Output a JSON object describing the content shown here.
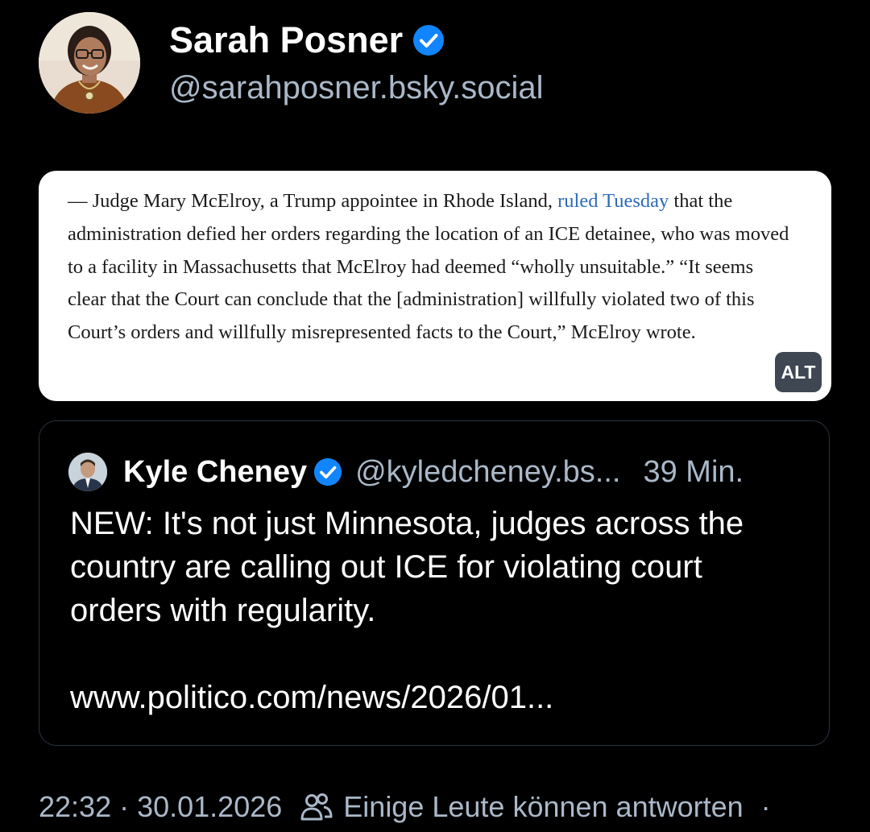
{
  "author": {
    "display_name": "Sarah Posner",
    "handle": "@sarahposner.bsky.social",
    "verified_icon": "verified-checkmark-icon"
  },
  "image_card": {
    "text_before_link": "— Judge Mary McElroy, a Trump appointee in Rhode Island, ",
    "link_text": "ruled Tuesday",
    "text_after_link": " that the administration defied her orders regarding the location of an ICE detainee, who was moved to a facility in Massachusetts that McElroy had deemed “wholly unsuitable.” “It seems clear that the Court can conclude that the [administration] willfully violated two of this Court’s orders and willfully misrepresented facts to the Court,” McElroy wrote.",
    "alt_badge": "ALT"
  },
  "quoted_post": {
    "display_name": "Kyle Cheney",
    "handle": "@kyledcheney.bs...",
    "time": "39 Min.",
    "body": "NEW: It's not just Minnesota, judges across the country are calling out ICE for violating court orders with regularity.",
    "url": "www.politico.com/news/2026/01..."
  },
  "footer": {
    "time": "22:32",
    "separator": "·",
    "date": "30.01.2026",
    "reply_setting": "Einige Leute können antworten",
    "trailing_separator": "·"
  },
  "colors": {
    "background": "#000000",
    "muted_text": "#aab8c8",
    "verified_blue": "#1185fe",
    "link_blue": "#2d6ab8",
    "card_border": "#2b3440"
  }
}
